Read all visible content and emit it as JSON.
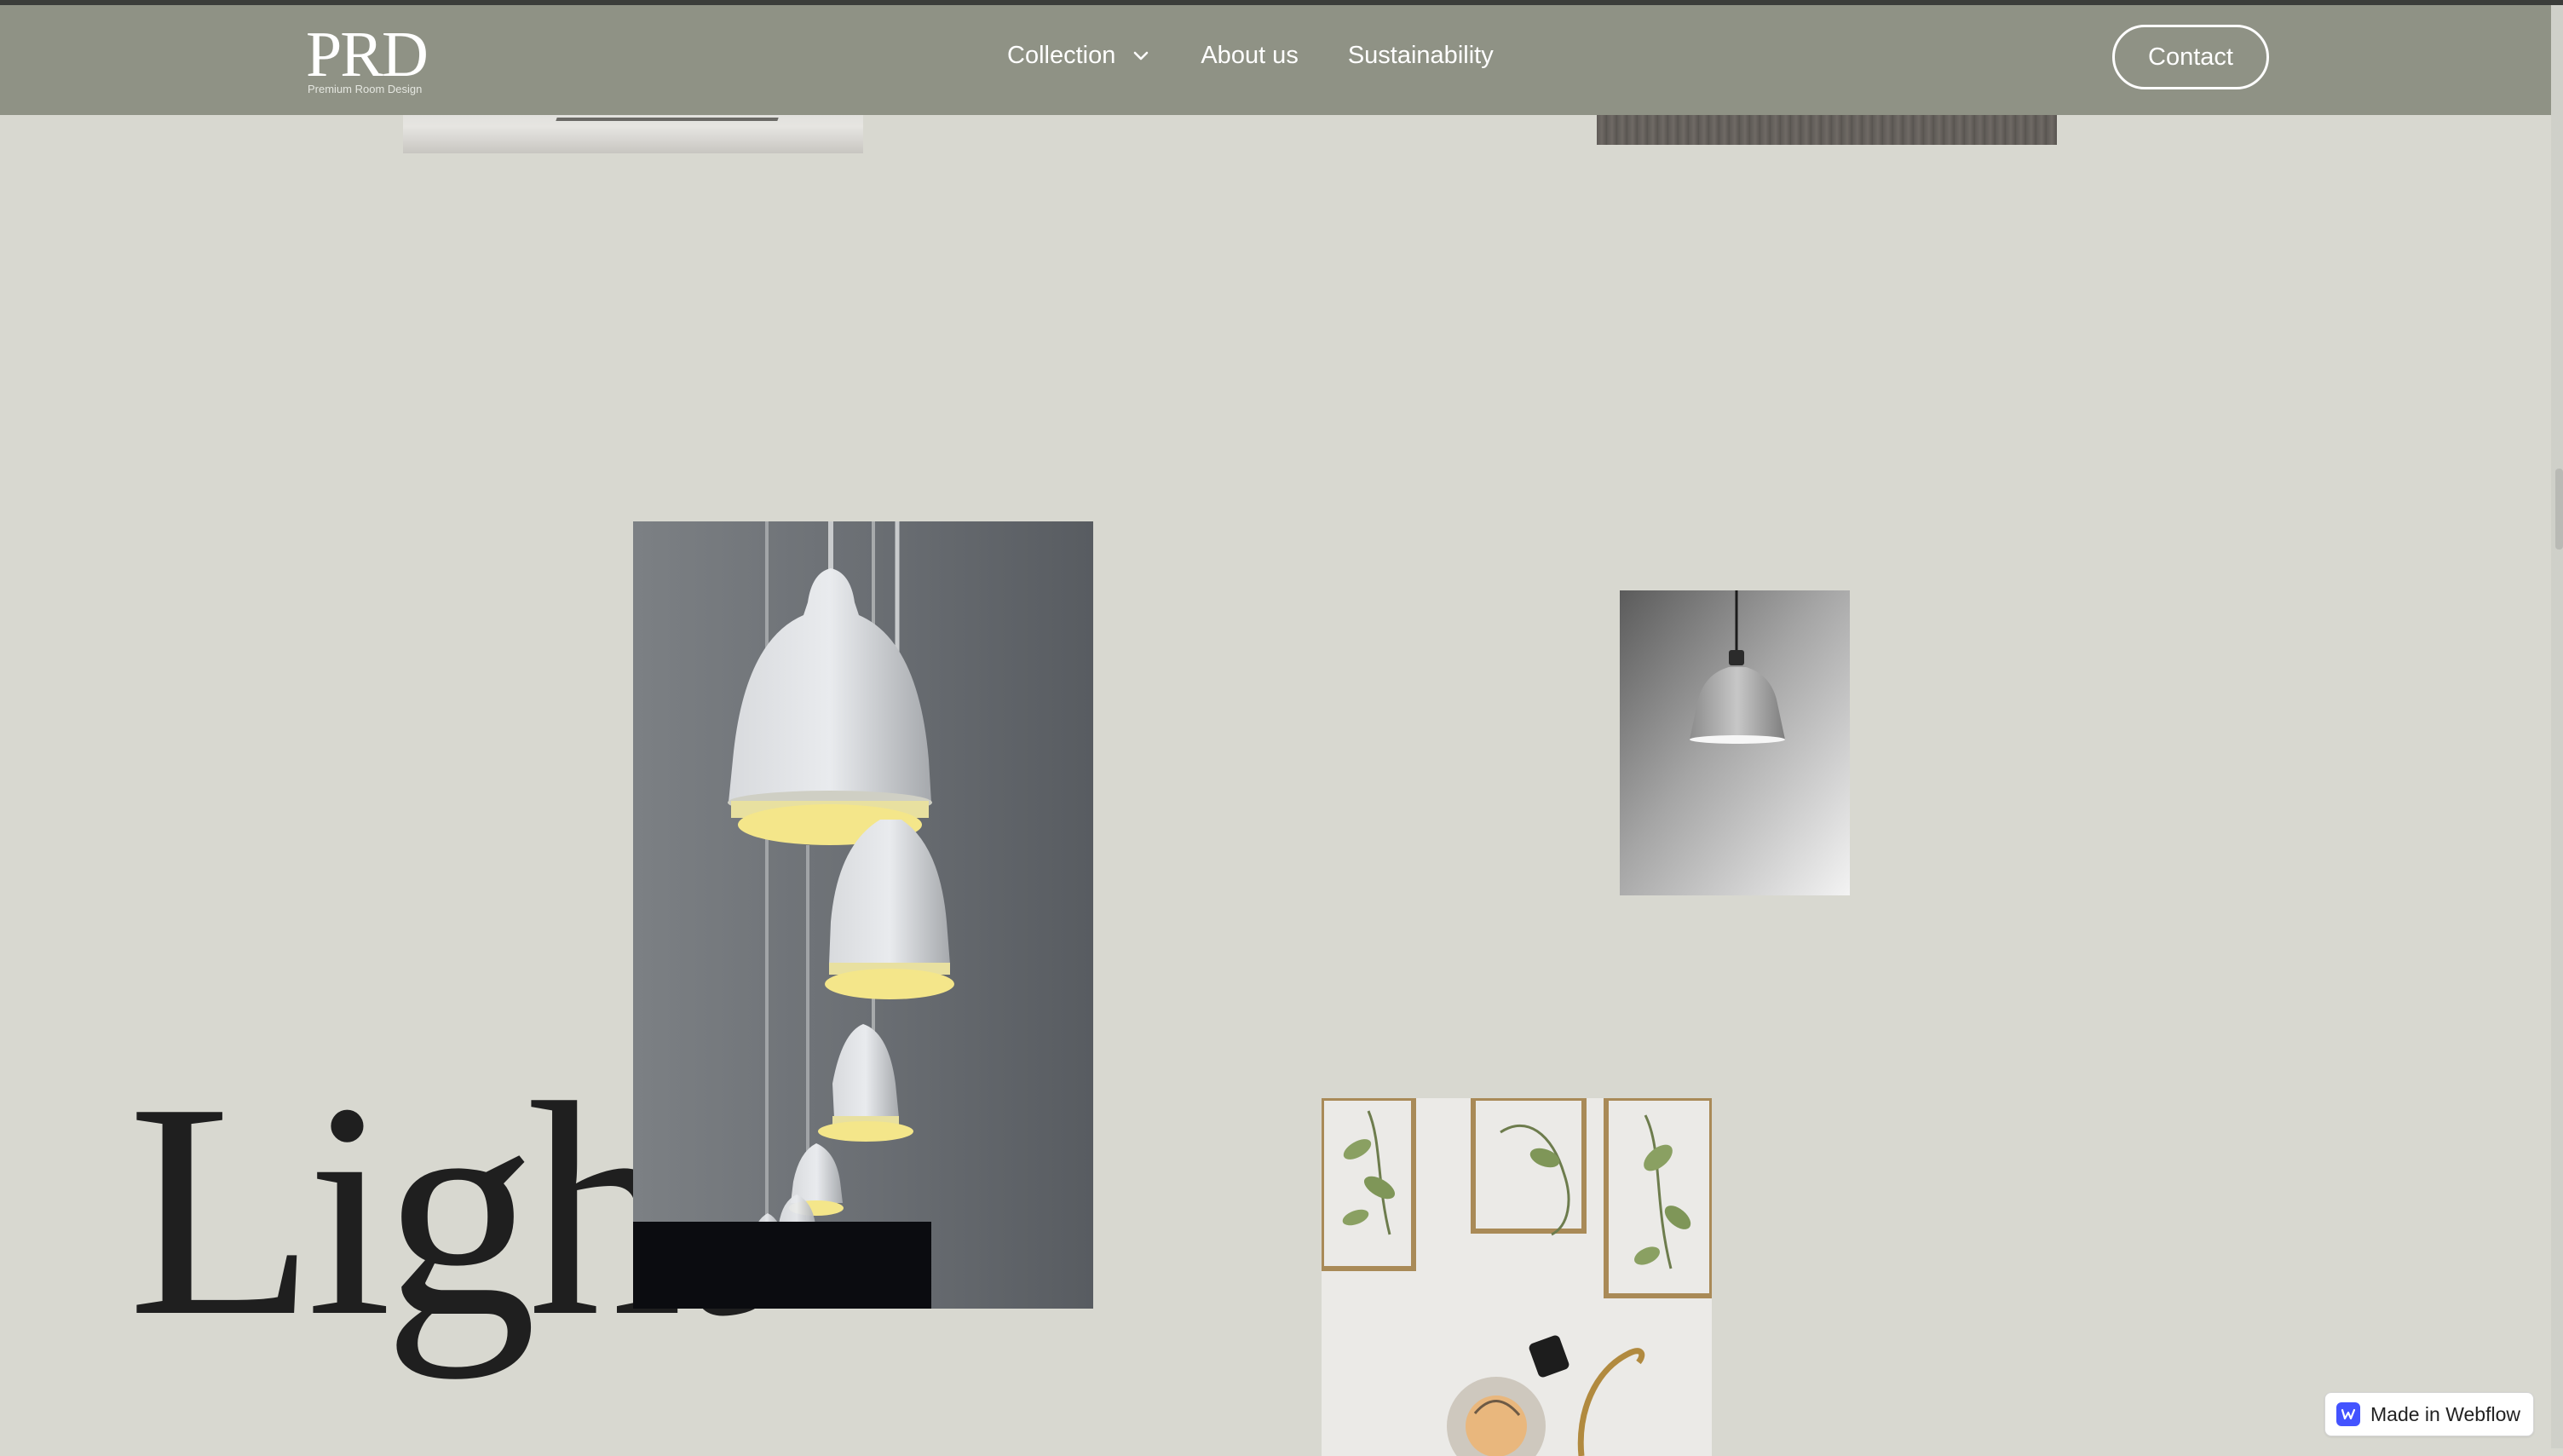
{
  "brand": {
    "logo_text": "PRD",
    "logo_subtitle": "Premium Room Design"
  },
  "nav": {
    "items": [
      {
        "label": "Collection",
        "has_dropdown": true
      },
      {
        "label": "About us"
      },
      {
        "label": "Sustainability"
      }
    ],
    "contact_label": "Contact"
  },
  "hero": {
    "word": "Light"
  },
  "badge": {
    "label": "Made in Webflow"
  },
  "colors": {
    "navbar_bg": "#8f9285",
    "page_bg": "#d8d8d0",
    "heading_text": "#1f1f1f",
    "lamp_glow": "#f4e68a"
  },
  "icons": {
    "dropdown": "chevron-down-icon",
    "webflow": "webflow-logo-icon"
  }
}
